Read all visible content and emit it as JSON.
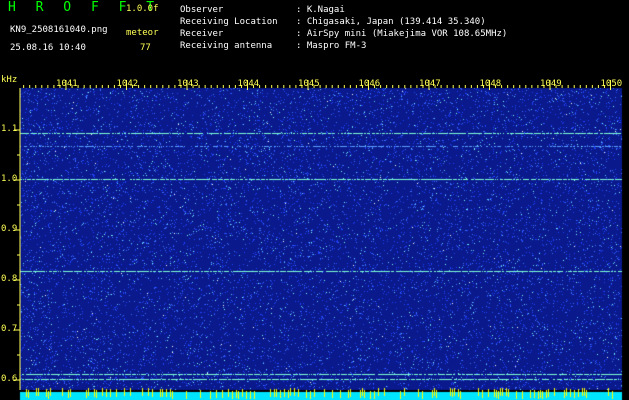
{
  "app": {
    "logo": "H R O F F T",
    "version": "1.0.0f",
    "filename": "KN9_2508161040.png",
    "mode": "meteor",
    "timestamp": "25.08.16 10:40",
    "count": "77"
  },
  "info": {
    "rows": [
      {
        "label": "Observer",
        "value": ": K.Nagai"
      },
      {
        "label": "Receiving Location",
        "value": ": Chigasaki, Japan (139.414 35.340)"
      },
      {
        "label": "Receiver",
        "value": ": AirSpy mini (Miakejima VOR 108.65MHz)"
      },
      {
        "label": "Receiving antenna",
        "value": ": Maspro FM-3"
      }
    ]
  },
  "plot": {
    "y_unit": "kHz",
    "y_ticks": [
      "1.1",
      "1.0",
      "0.9",
      "0.8",
      "0.7",
      "0.6"
    ],
    "x_ticks": [
      "1041",
      "1042",
      "1043",
      "1044",
      "1045",
      "1046",
      "1047",
      "1048",
      "1049",
      "1050"
    ],
    "bg_color": "#0a1a8c",
    "noise_colors": [
      "#2040ff",
      "#3a6cff",
      "#60c8ff",
      "#80ffff",
      "#ffffff"
    ],
    "carrier_color": "#7fffd4",
    "bottom_band_color": "#00e5ff"
  }
}
